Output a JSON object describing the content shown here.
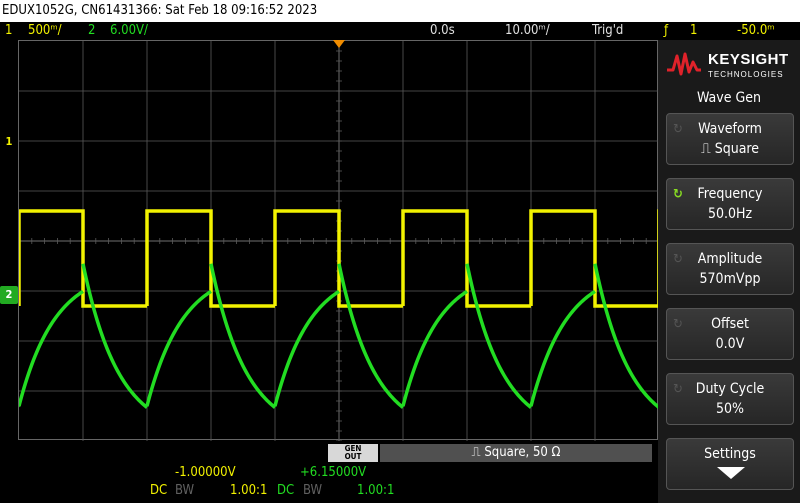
{
  "title_bar": "EDUX1052G, CN61431366: Sat Feb 18 09:16:52 2023",
  "status": {
    "ch1_num": "1",
    "ch1_scale": "500ᵐ/",
    "ch2_num": "2",
    "ch2_scale": "6.00V/",
    "time_delay": "0.0s",
    "time_scale": "10.00ᵐ/",
    "trig_state": "Trig'd",
    "trig_icon": "ƒ",
    "trig_src": "1",
    "trig_level": "-50.0ᵐ"
  },
  "markers": {
    "ch1": "1",
    "ch2": "2"
  },
  "gen_out": {
    "line1": "GEN",
    "line2": "OUT",
    "info": "Square, 50 Ω"
  },
  "readouts": {
    "ch1_offset": "-1.00000V",
    "ch2_offset": "+6.15000V",
    "ch1_coupling": "DC",
    "ch1_bw": "BW",
    "ch1_probe": "1.00:1",
    "ch2_coupling": "DC",
    "ch2_bw": "BW",
    "ch2_probe": "1.00:1"
  },
  "brand": {
    "name": "KEYSIGHT",
    "sub": "TECHNOLOGIES"
  },
  "menu": {
    "title": "Wave Gen",
    "keys": [
      {
        "label": "Waveform",
        "value": "⎍ Square"
      },
      {
        "label": "Frequency",
        "value": "50.0Hz"
      },
      {
        "label": "Amplitude",
        "value": "570mVpp"
      },
      {
        "label": "Offset",
        "value": "0.0V"
      },
      {
        "label": "Duty Cycle",
        "value": "50%"
      },
      {
        "label": "Settings",
        "value": ""
      }
    ]
  },
  "colors": {
    "ch1": "#f2f200",
    "ch2": "#22dd22",
    "trigger": "#f08c00",
    "grid": "#5a5a5a"
  },
  "chart_data": {
    "type": "line",
    "xlabel": "",
    "ylabel": "",
    "x_unit": "ms",
    "time_per_div_ms": 10,
    "x_range": [
      -50,
      50
    ],
    "grid": true,
    "series": [
      {
        "waveform": "square",
        "period_ms": 20,
        "duty": 0.5,
        "levels_divs": [
          2.7,
          4.6
        ],
        "color": "#f2f200"
      },
      {
        "waveform": "rc-response",
        "period_ms": 20,
        "duty": 0.5,
        "levels_divs": [
          0.75,
          3.8
        ],
        "color": "#22dd22"
      }
    ]
  }
}
